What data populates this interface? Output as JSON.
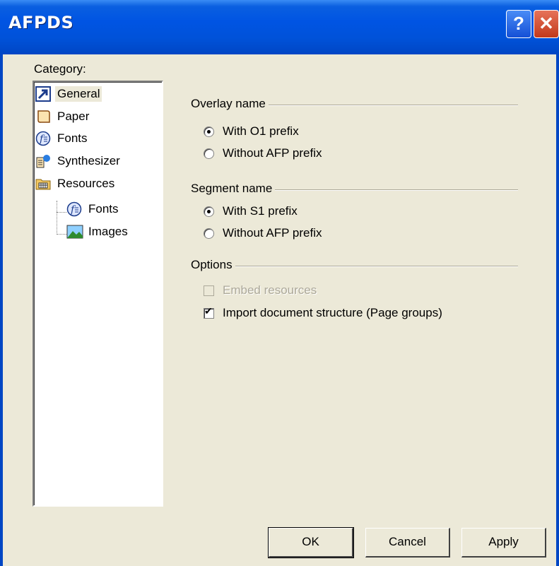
{
  "window": {
    "title": "AFPDS",
    "help_label": "?",
    "close_label": "✕"
  },
  "sidebar": {
    "label": "Category:",
    "items": [
      {
        "label": "General",
        "icon": "general-icon"
      },
      {
        "label": "Paper",
        "icon": "paper-icon"
      },
      {
        "label": "Fonts",
        "icon": "fonts-icon"
      },
      {
        "label": "Synthesizer",
        "icon": "synthesizer-icon"
      },
      {
        "label": "Resources",
        "icon": "resources-icon"
      },
      {
        "label": "Fonts",
        "icon": "fonts-icon"
      },
      {
        "label": "Images",
        "icon": "images-icon"
      }
    ]
  },
  "overlay": {
    "title": "Overlay name",
    "options": [
      {
        "label": "With O1 prefix",
        "selected": true
      },
      {
        "label": "Without AFP prefix",
        "selected": false
      }
    ]
  },
  "segment": {
    "title": "Segment name",
    "options": [
      {
        "label": "With S1 prefix",
        "selected": true
      },
      {
        "label": "Without AFP prefix",
        "selected": false
      }
    ]
  },
  "options": {
    "title": "Options",
    "embed_label": "Embed resources",
    "embed_checked": false,
    "embed_enabled": false,
    "import_label": "Import document structure (Page groups)",
    "import_checked": true
  },
  "buttons": {
    "ok": "OK",
    "cancel": "Cancel",
    "apply": "Apply"
  }
}
